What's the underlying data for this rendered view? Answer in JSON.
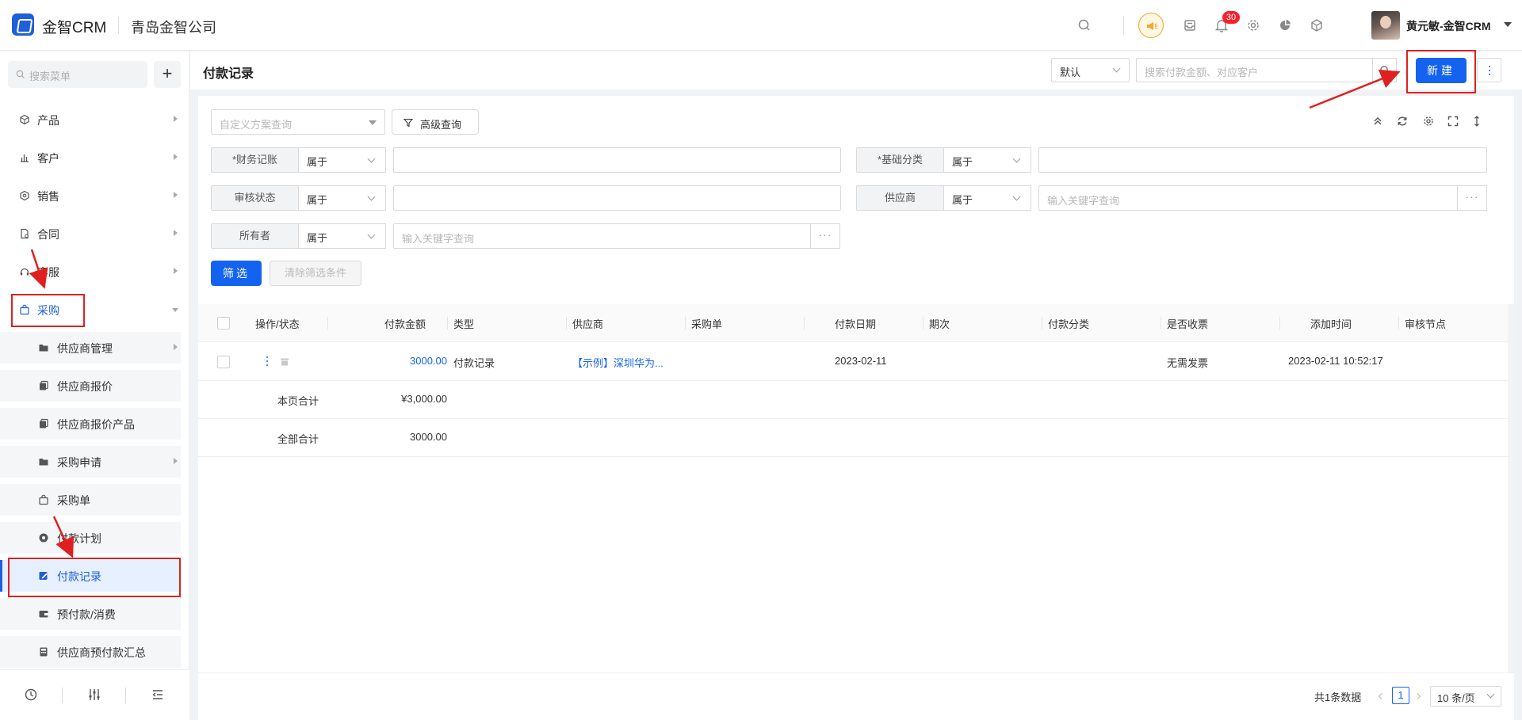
{
  "header": {
    "brand": "金智CRM",
    "company": "青岛金智公司",
    "notification_count": "30",
    "user_name": "黄元敏-金智CRM"
  },
  "sidebar": {
    "search_placeholder": "搜索菜单",
    "items": [
      {
        "label": "产品",
        "icon": "cube-icon"
      },
      {
        "label": "客户",
        "icon": "chart-icon"
      },
      {
        "label": "销售",
        "icon": "hexagon-icon"
      },
      {
        "label": "合同",
        "icon": "document-icon"
      },
      {
        "label": "客服",
        "icon": "headset-icon"
      },
      {
        "label": "采购",
        "icon": "bag-icon"
      }
    ],
    "sub_items": [
      {
        "label": "供应商管理",
        "icon": "folder-icon"
      },
      {
        "label": "供应商报价",
        "icon": "copy-icon"
      },
      {
        "label": "供应商报价产品",
        "icon": "copy-icon"
      },
      {
        "label": "采购申请",
        "icon": "folder-icon"
      },
      {
        "label": "采购单",
        "icon": "bag-icon"
      },
      {
        "label": "付款计划",
        "icon": "circle-icon"
      },
      {
        "label": "付款记录",
        "icon": "edit-icon"
      },
      {
        "label": "预付款/消费",
        "icon": "wallet-icon"
      },
      {
        "label": "供应商预付款汇总",
        "icon": "calculator-icon"
      }
    ]
  },
  "page": {
    "title": "付款记录",
    "view_select": "默认",
    "search_placeholder": "搜索付款金额、对应客户",
    "new_button": "新建"
  },
  "filters": {
    "scheme_placeholder": "自定义方案查询",
    "advanced_button": "高级查询",
    "rows": [
      {
        "label": "*财务记账",
        "op": "属于",
        "value": ""
      },
      {
        "label": "*基础分类",
        "op": "属于",
        "value": ""
      },
      {
        "label": "审核状态",
        "op": "属于",
        "value": ""
      },
      {
        "label": "供应商",
        "op": "属于",
        "placeholder": "输入关键字查询"
      },
      {
        "label": "所有者",
        "op": "属于",
        "placeholder": "输入关键字查询"
      }
    ],
    "filter_button": "筛选",
    "clear_button": "清除筛选条件"
  },
  "table": {
    "columns": [
      "操作/状态",
      "付款金额",
      "类型",
      "供应商",
      "采购单",
      "付款日期",
      "期次",
      "付款分类",
      "是否收票",
      "添加时间",
      "审核节点"
    ],
    "rows": [
      {
        "amount": "3000.00",
        "type": "付款记录",
        "supplier": "【示例】深圳华为...",
        "purchase_order": "",
        "pay_date": "2023-02-11",
        "period": "",
        "category": "",
        "invoice": "无需发票",
        "added": "2023-02-11 10:52:17",
        "audit": ""
      }
    ],
    "page_total_label": "本页合计",
    "page_total_value": "¥3,000.00",
    "all_total_label": "全部合计",
    "all_total_value": "3000.00"
  },
  "pager": {
    "total_text": "共1条数据",
    "current_page": "1",
    "page_size": "10 条/页"
  },
  "colors": {
    "primary": "#1463f0",
    "annotation": "#e02020",
    "badge": "#f5222d"
  }
}
